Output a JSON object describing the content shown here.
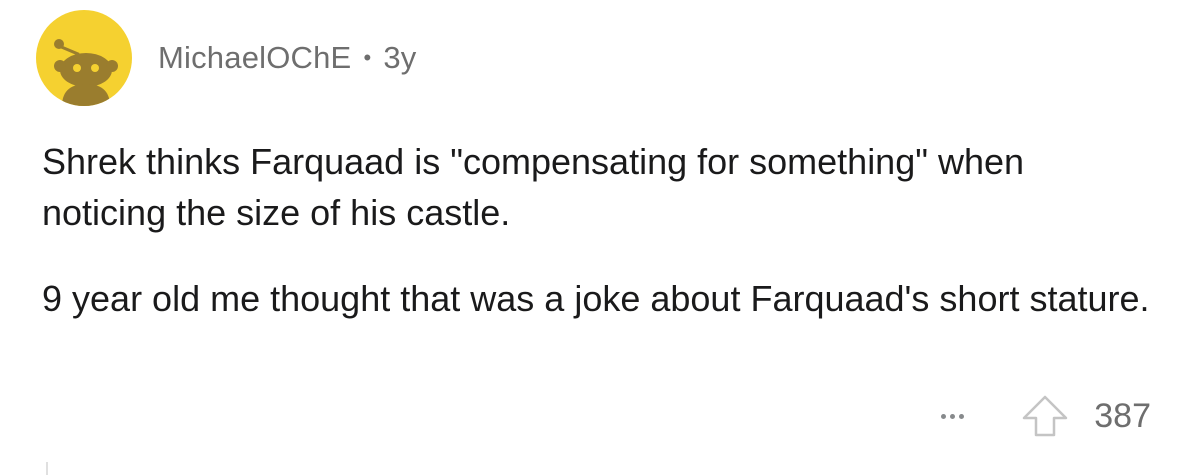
{
  "comment": {
    "author": "MichaelOChE",
    "separator": "•",
    "age": "3y",
    "paragraphs": [
      "Shrek thinks Farquaad is \"compensating for something\" when noticing the size of his castle.",
      "9 year old me thought that was a joke about Farquaad's short stature."
    ],
    "score": "387"
  },
  "colors": {
    "avatar_bg": "#f5d130",
    "snoo": "#9a7d2e",
    "meta_text": "#6e6e6e",
    "body_text": "#1a1a1b"
  },
  "icons": {
    "avatar": "reddit-snoo-avatar",
    "more": "more-options-icon",
    "upvote": "upvote-arrow-icon"
  }
}
